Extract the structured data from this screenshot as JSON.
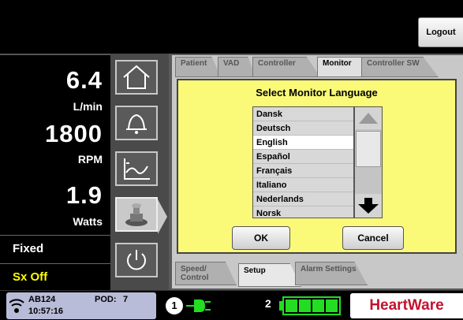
{
  "header": {
    "logout_label": "Logout"
  },
  "metrics": {
    "flow_value": "6.4",
    "flow_unit": "L/min",
    "speed_value": "1800",
    "speed_unit": "RPM",
    "power_value": "1.9",
    "power_unit": "Watts"
  },
  "mode": {
    "speed_mode": "Fixed",
    "suction": "Sx Off",
    "suction_color": "#ffff00"
  },
  "nav": {
    "icons": [
      "home-icon",
      "bell-icon",
      "trend-icon",
      "stethoscope-icon",
      "power-icon"
    ]
  },
  "tabs_top": [
    {
      "label": "Patient"
    },
    {
      "label": "VAD"
    },
    {
      "label": "Controller"
    },
    {
      "label": "Monitor"
    },
    {
      "label": "Controller SW"
    }
  ],
  "tabs_bottom": [
    {
      "label": "Speed/ Control"
    },
    {
      "label": "Setup"
    },
    {
      "label": "Alarm Settings"
    }
  ],
  "dialog": {
    "title": "Select Monitor Language",
    "languages": [
      "Dansk",
      "Deutsch",
      "English",
      "Español",
      "Français",
      "Italiano",
      "Nederlands",
      "Norsk"
    ],
    "selected": "English",
    "ok_label": "OK",
    "cancel_label": "Cancel",
    "background_color": "#fafa78"
  },
  "status": {
    "device_id": "AB124",
    "pod_label": "POD:",
    "pod_value": "7",
    "time": "10:57:16",
    "power_source_1": "1",
    "power_source_2": "2",
    "brand": "HeartWare",
    "brand_color": "#c4122f",
    "battery_color": "#22dd22"
  }
}
